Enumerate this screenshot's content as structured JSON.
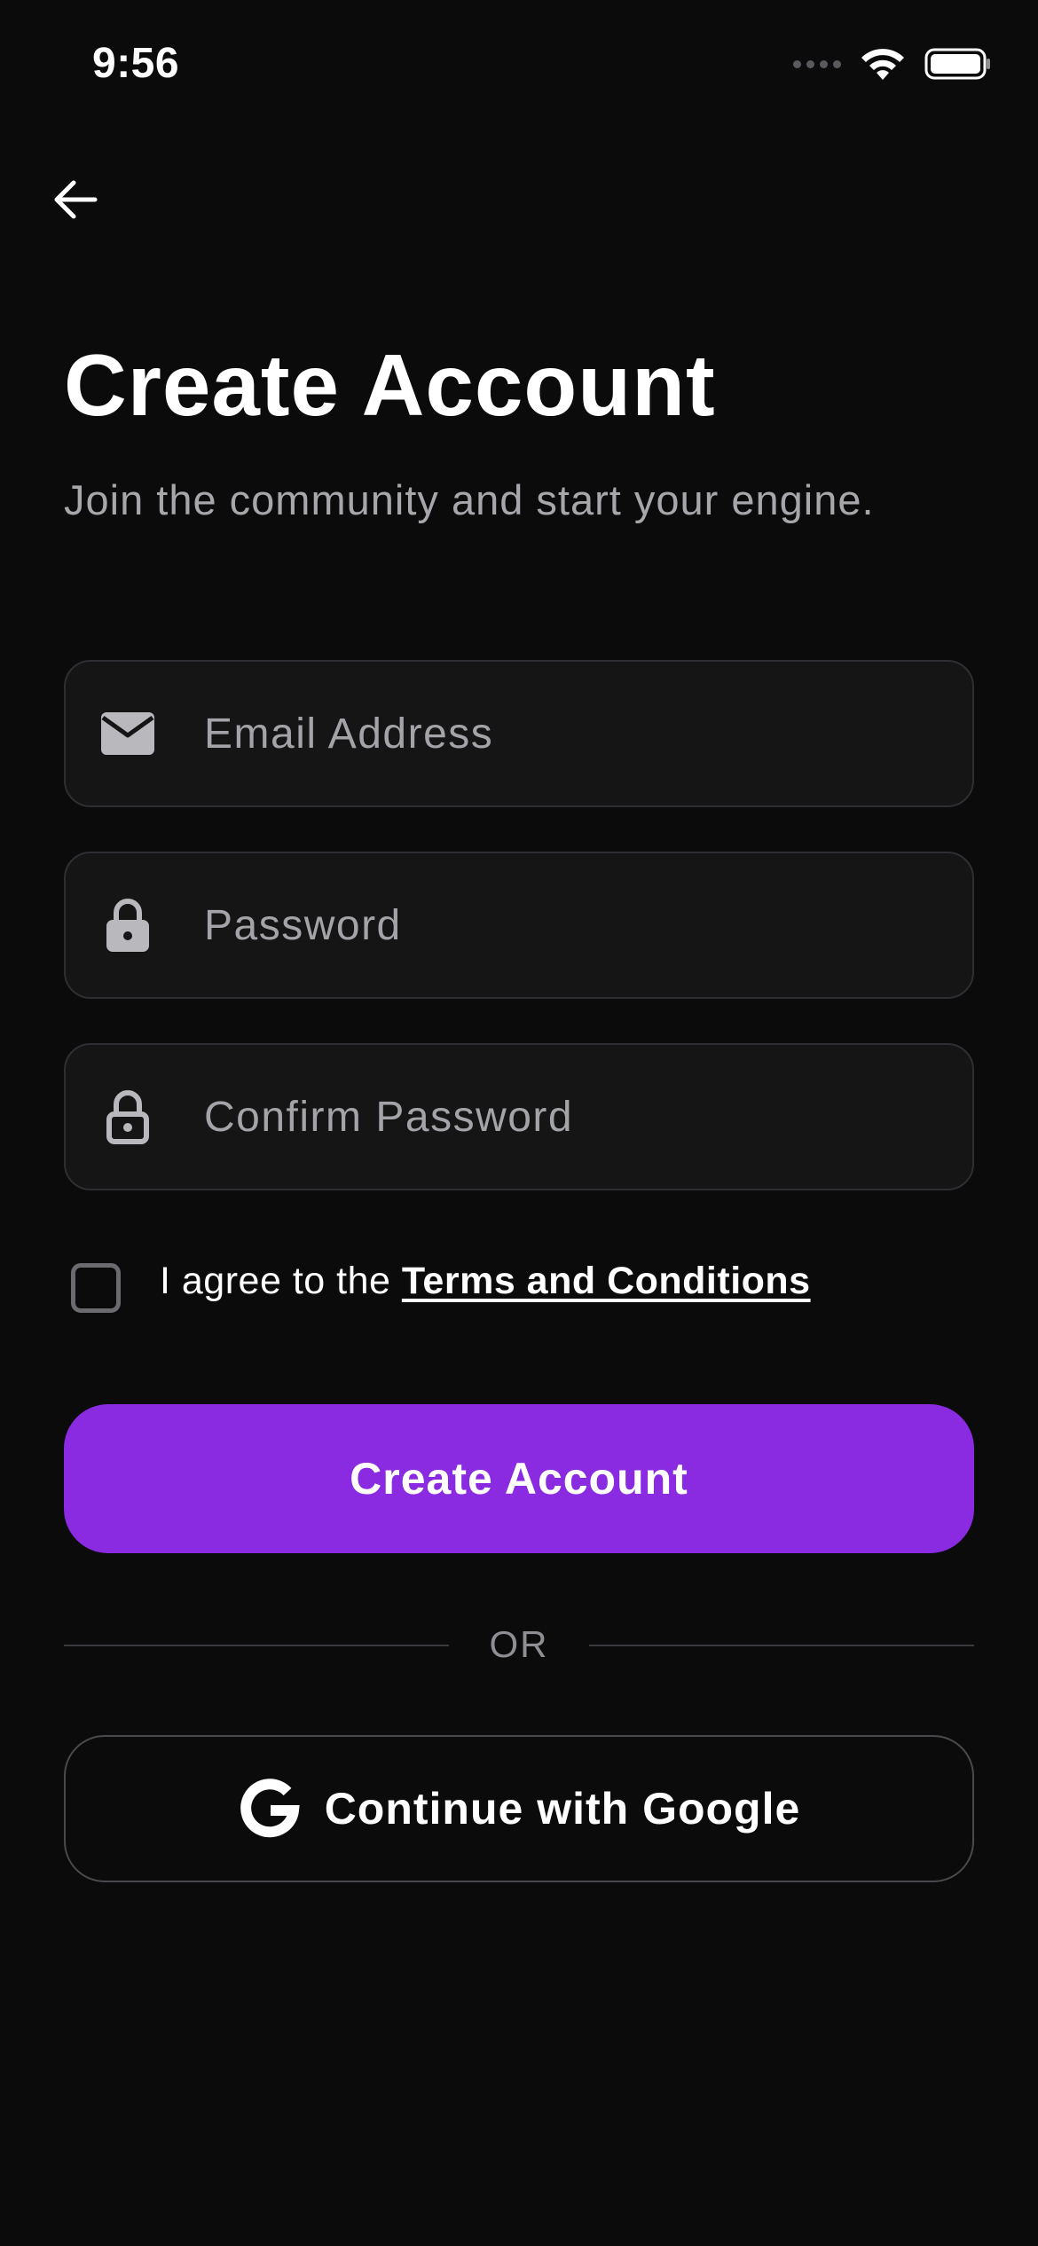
{
  "status_bar": {
    "time": "9:56"
  },
  "navigation": {
    "back_icon": "arrow-left-icon"
  },
  "header": {
    "title": "Create Account",
    "subtitle": "Join the community and start your engine."
  },
  "form": {
    "email": {
      "placeholder": "Email Address",
      "value": "",
      "icon": "envelope-icon"
    },
    "password": {
      "placeholder": "Password",
      "value": "",
      "icon": "lock-icon"
    },
    "confirm_password": {
      "placeholder": "Confirm Password",
      "value": "",
      "icon": "lock-outline-icon"
    },
    "terms": {
      "checked": false,
      "prefix": "I agree to the ",
      "link_label": "Terms and Conditions"
    },
    "submit_label": "Create Account"
  },
  "divider": {
    "label": "OR"
  },
  "social": {
    "google_label": "Continue with Google",
    "google_icon": "google-icon"
  },
  "colors": {
    "background": "#0b0b0c",
    "accent": "#8a2be2",
    "field_background": "#151516",
    "field_border": "#2f2f33",
    "placeholder": "#a3a3a8",
    "subtitle": "#a6a6ab"
  }
}
